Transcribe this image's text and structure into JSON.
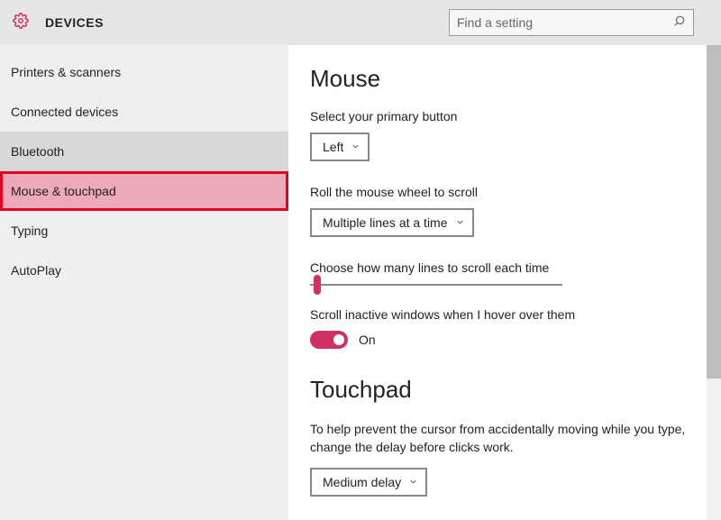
{
  "header": {
    "title": "DEVICES",
    "search_placeholder": "Find a setting"
  },
  "sidebar": {
    "items": [
      {
        "label": "Printers & scanners"
      },
      {
        "label": "Connected devices"
      },
      {
        "label": "Bluetooth"
      },
      {
        "label": "Mouse & touchpad"
      },
      {
        "label": "Typing"
      },
      {
        "label": "AutoPlay"
      }
    ]
  },
  "main": {
    "mouse": {
      "title": "Mouse",
      "primary_button": {
        "label": "Select your primary button",
        "value": "Left"
      },
      "wheel_scroll": {
        "label": "Roll the mouse wheel to scroll",
        "value": "Multiple lines at a time"
      },
      "lines_scroll": {
        "label": "Choose how many lines to scroll each time"
      },
      "inactive_hover": {
        "label": "Scroll inactive windows when I hover over them",
        "value": "On"
      }
    },
    "touchpad": {
      "title": "Touchpad",
      "desc": "To help prevent the cursor from accidentally moving while you type, change the delay before clicks work.",
      "delay_value": "Medium delay"
    }
  }
}
